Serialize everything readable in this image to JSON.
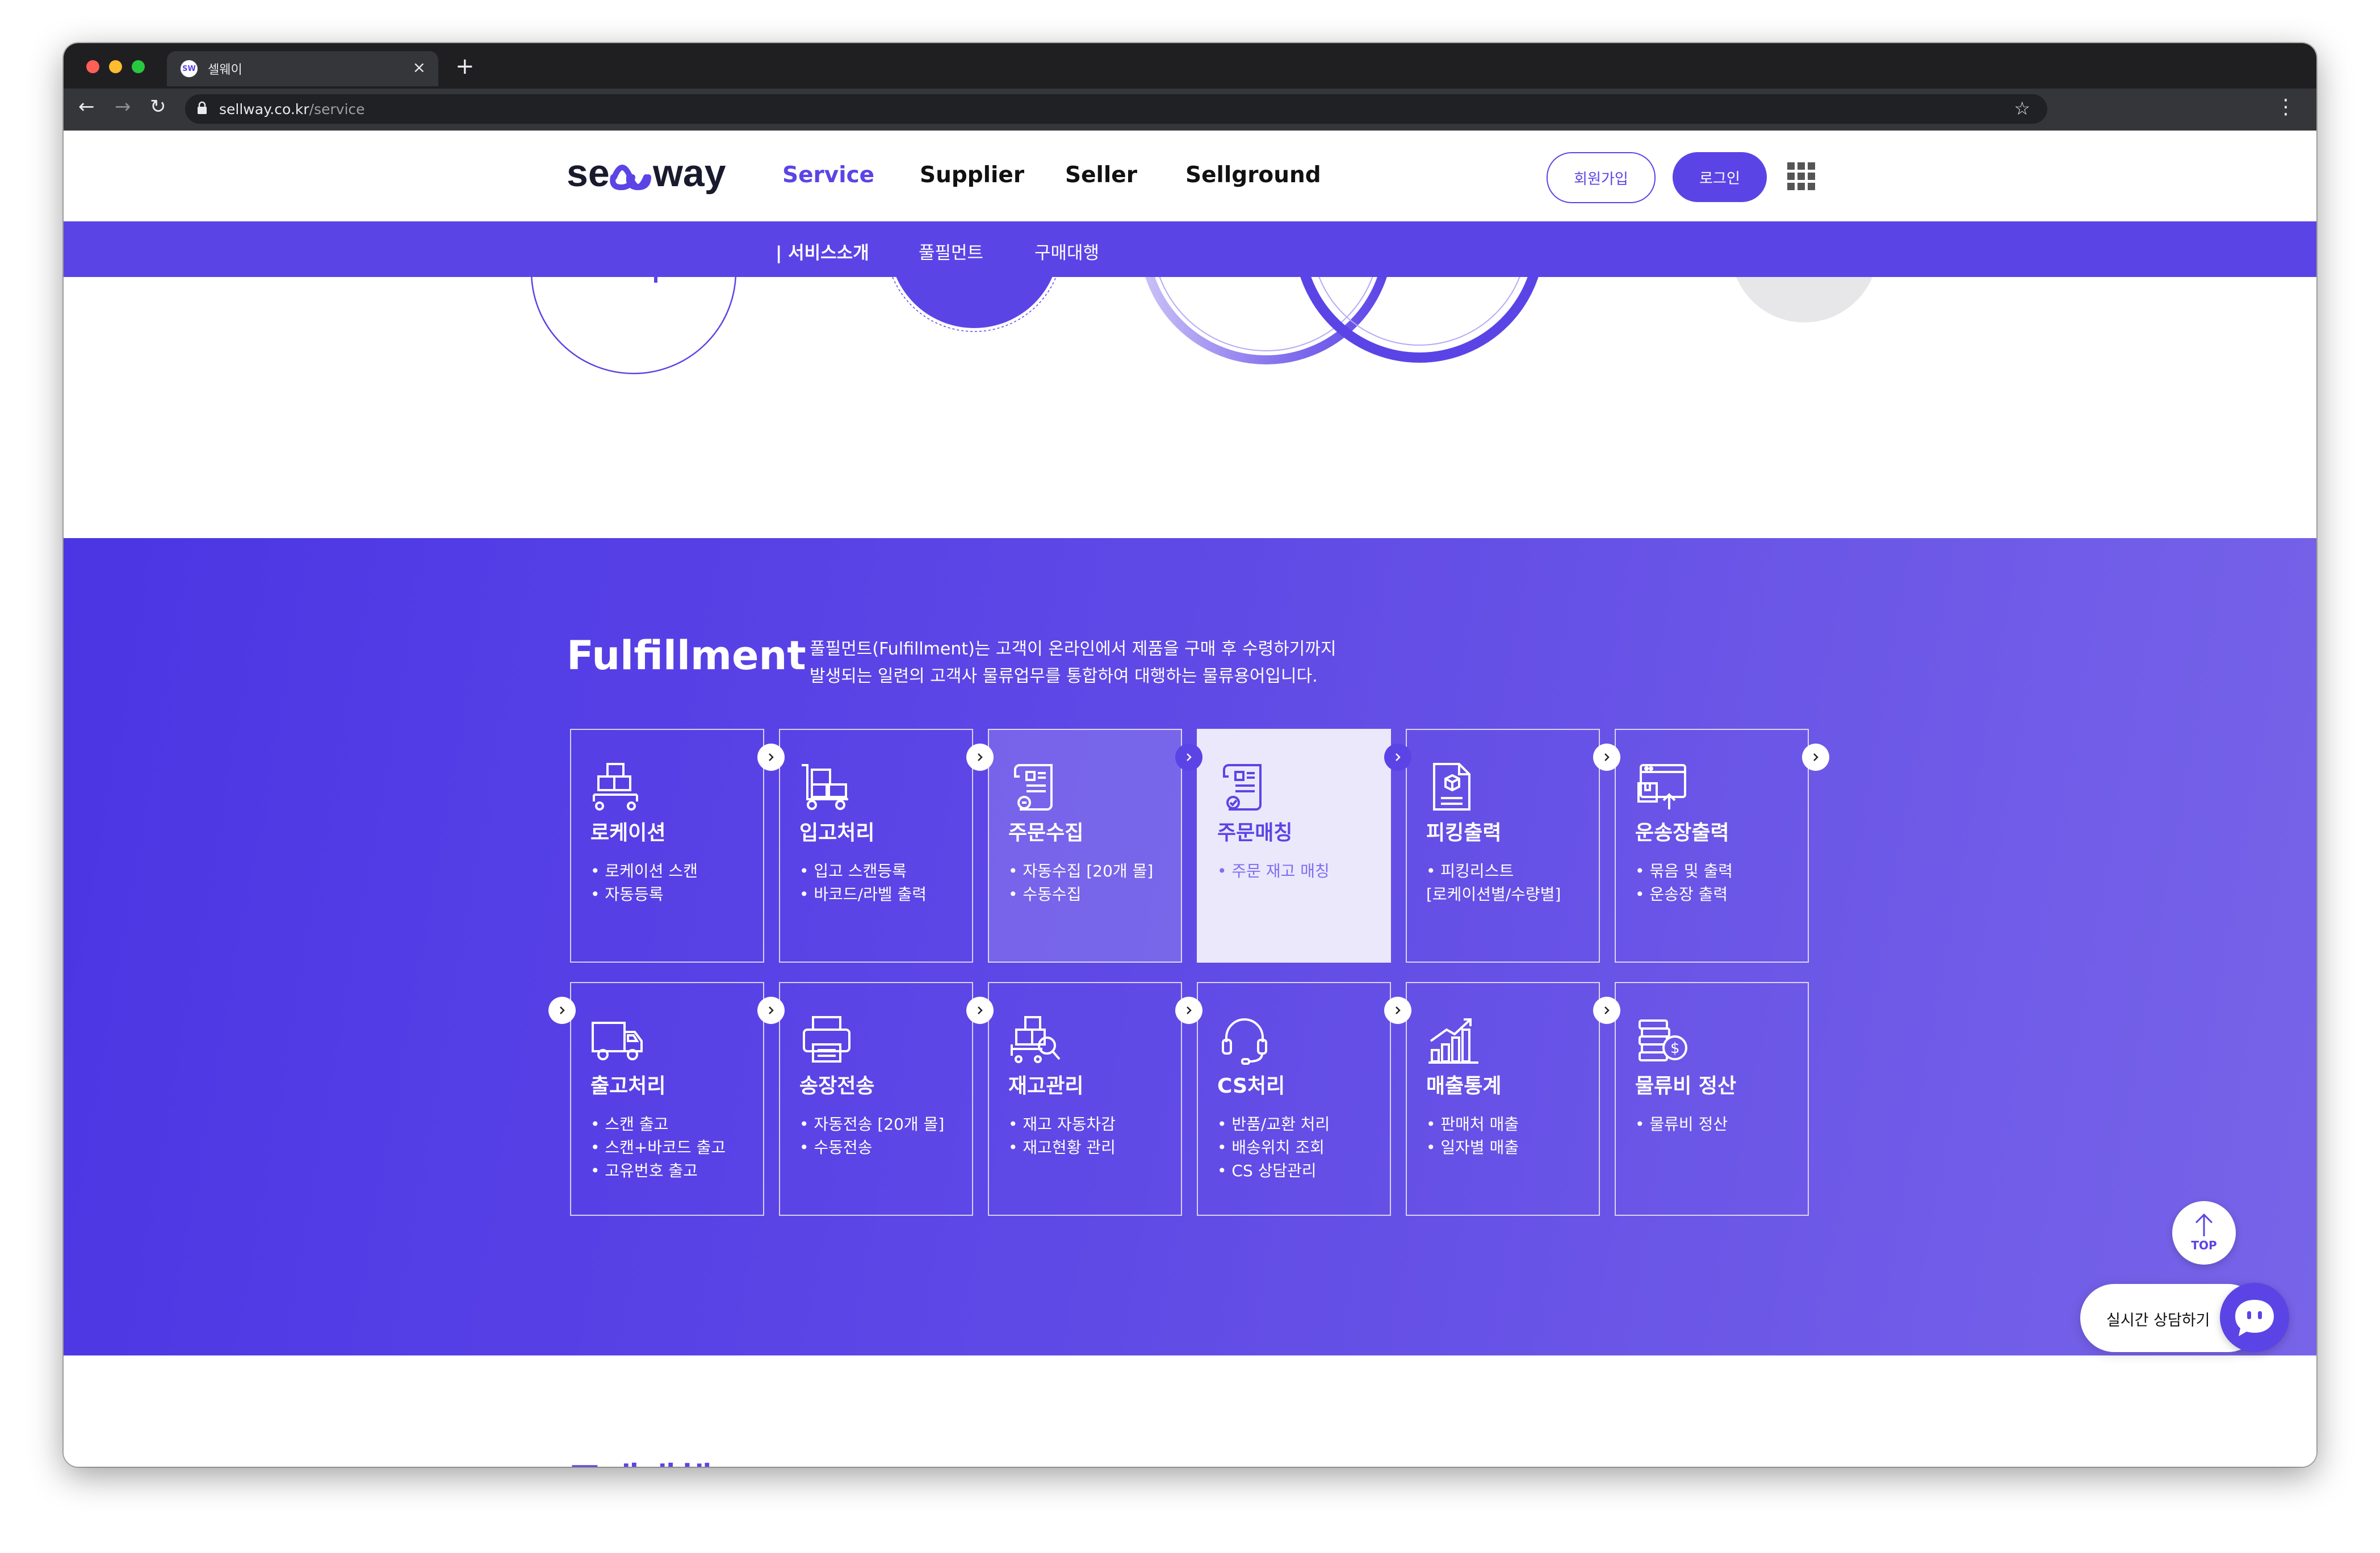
{
  "browser": {
    "tab_title": "셀웨이",
    "tab_favicon_text": "SW",
    "url_host": "sellway.co.kr",
    "url_path": "/service"
  },
  "header": {
    "logo_text": "sellway",
    "nav": [
      {
        "label": "Service",
        "active": true
      },
      {
        "label": "Supplier",
        "active": false
      },
      {
        "label": "Seller",
        "active": false
      },
      {
        "label": "Sellground",
        "active": false
      }
    ],
    "signup_label": "회원가입",
    "login_label": "로그인"
  },
  "subnav": {
    "items": [
      {
        "label": "| 서비스소개",
        "active": true
      },
      {
        "label": "풀필먼트",
        "active": false
      },
      {
        "label": "구매대행",
        "active": false
      }
    ]
  },
  "fulfillment": {
    "title": "Fulfillment",
    "desc_line1": "풀필먼트(Fulfillment)는 고객이 온라인에서 제품을 구매 후 수령하기까지",
    "desc_line2": "발생되는 일련의 고객사 물류업무를 통합하여 대행하는 물류용어입니다.",
    "cards": [
      {
        "title": "로케이션",
        "items": [
          "• 로케이션 스캔",
          "• 자동등록"
        ],
        "icon": "boxes-on-cart-icon",
        "state": "normal"
      },
      {
        "title": "입고처리",
        "items": [
          "• 입고 스캔등록",
          "• 바코드/라벨 출력"
        ],
        "icon": "hand-truck-icon",
        "state": "normal"
      },
      {
        "title": "주문수집",
        "items": [
          "• 자동수집 [20개 몰]",
          "• 수동수집"
        ],
        "icon": "order-scroll-icon",
        "state": "hover"
      },
      {
        "title": "주문매칭",
        "items": [
          "• 주문 재고 매칭"
        ],
        "icon": "order-match-icon",
        "state": "active"
      },
      {
        "title": "피킹출력",
        "items": [
          "• 피킹리스트",
          "[로케이션별/수량별]"
        ],
        "icon": "picking-doc-icon",
        "state": "normal"
      },
      {
        "title": "운송장출력",
        "items": [
          "• 묶음 및 출력",
          "• 운송장 출력"
        ],
        "icon": "waybill-print-icon",
        "state": "normal"
      },
      {
        "title": "출고처리",
        "items": [
          "• 스캔 출고",
          "• 스캔+바코드 출고",
          "• 고유번호 출고"
        ],
        "icon": "delivery-truck-icon",
        "state": "normal"
      },
      {
        "title": "송장전송",
        "items": [
          "• 자동전송 [20개 몰]",
          "• 수동전송"
        ],
        "icon": "printer-icon",
        "state": "normal"
      },
      {
        "title": "재고관리",
        "items": [
          "• 재고 자동차감",
          "• 재고현황 관리"
        ],
        "icon": "inventory-search-icon",
        "state": "normal"
      },
      {
        "title": "CS처리",
        "items": [
          "• 반품/교환 처리",
          "• 배송위치 조회",
          "• CS 상담관리"
        ],
        "icon": "headset-icon",
        "state": "normal"
      },
      {
        "title": "매출통계",
        "items": [
          "• 판매처 매출",
          "• 일자별 매출"
        ],
        "icon": "growth-chart-icon",
        "state": "normal"
      },
      {
        "title": "물류비 정산",
        "items": [
          "• 물류비 정산"
        ],
        "icon": "coins-icon",
        "state": "normal"
      }
    ]
  },
  "top_button_label": "TOP",
  "next_section_heading": "구매대행",
  "chat": {
    "label": "실시간 상담하기"
  },
  "colors": {
    "brand": "#5b44e6",
    "active_card_bg": "#ebe8fc"
  }
}
